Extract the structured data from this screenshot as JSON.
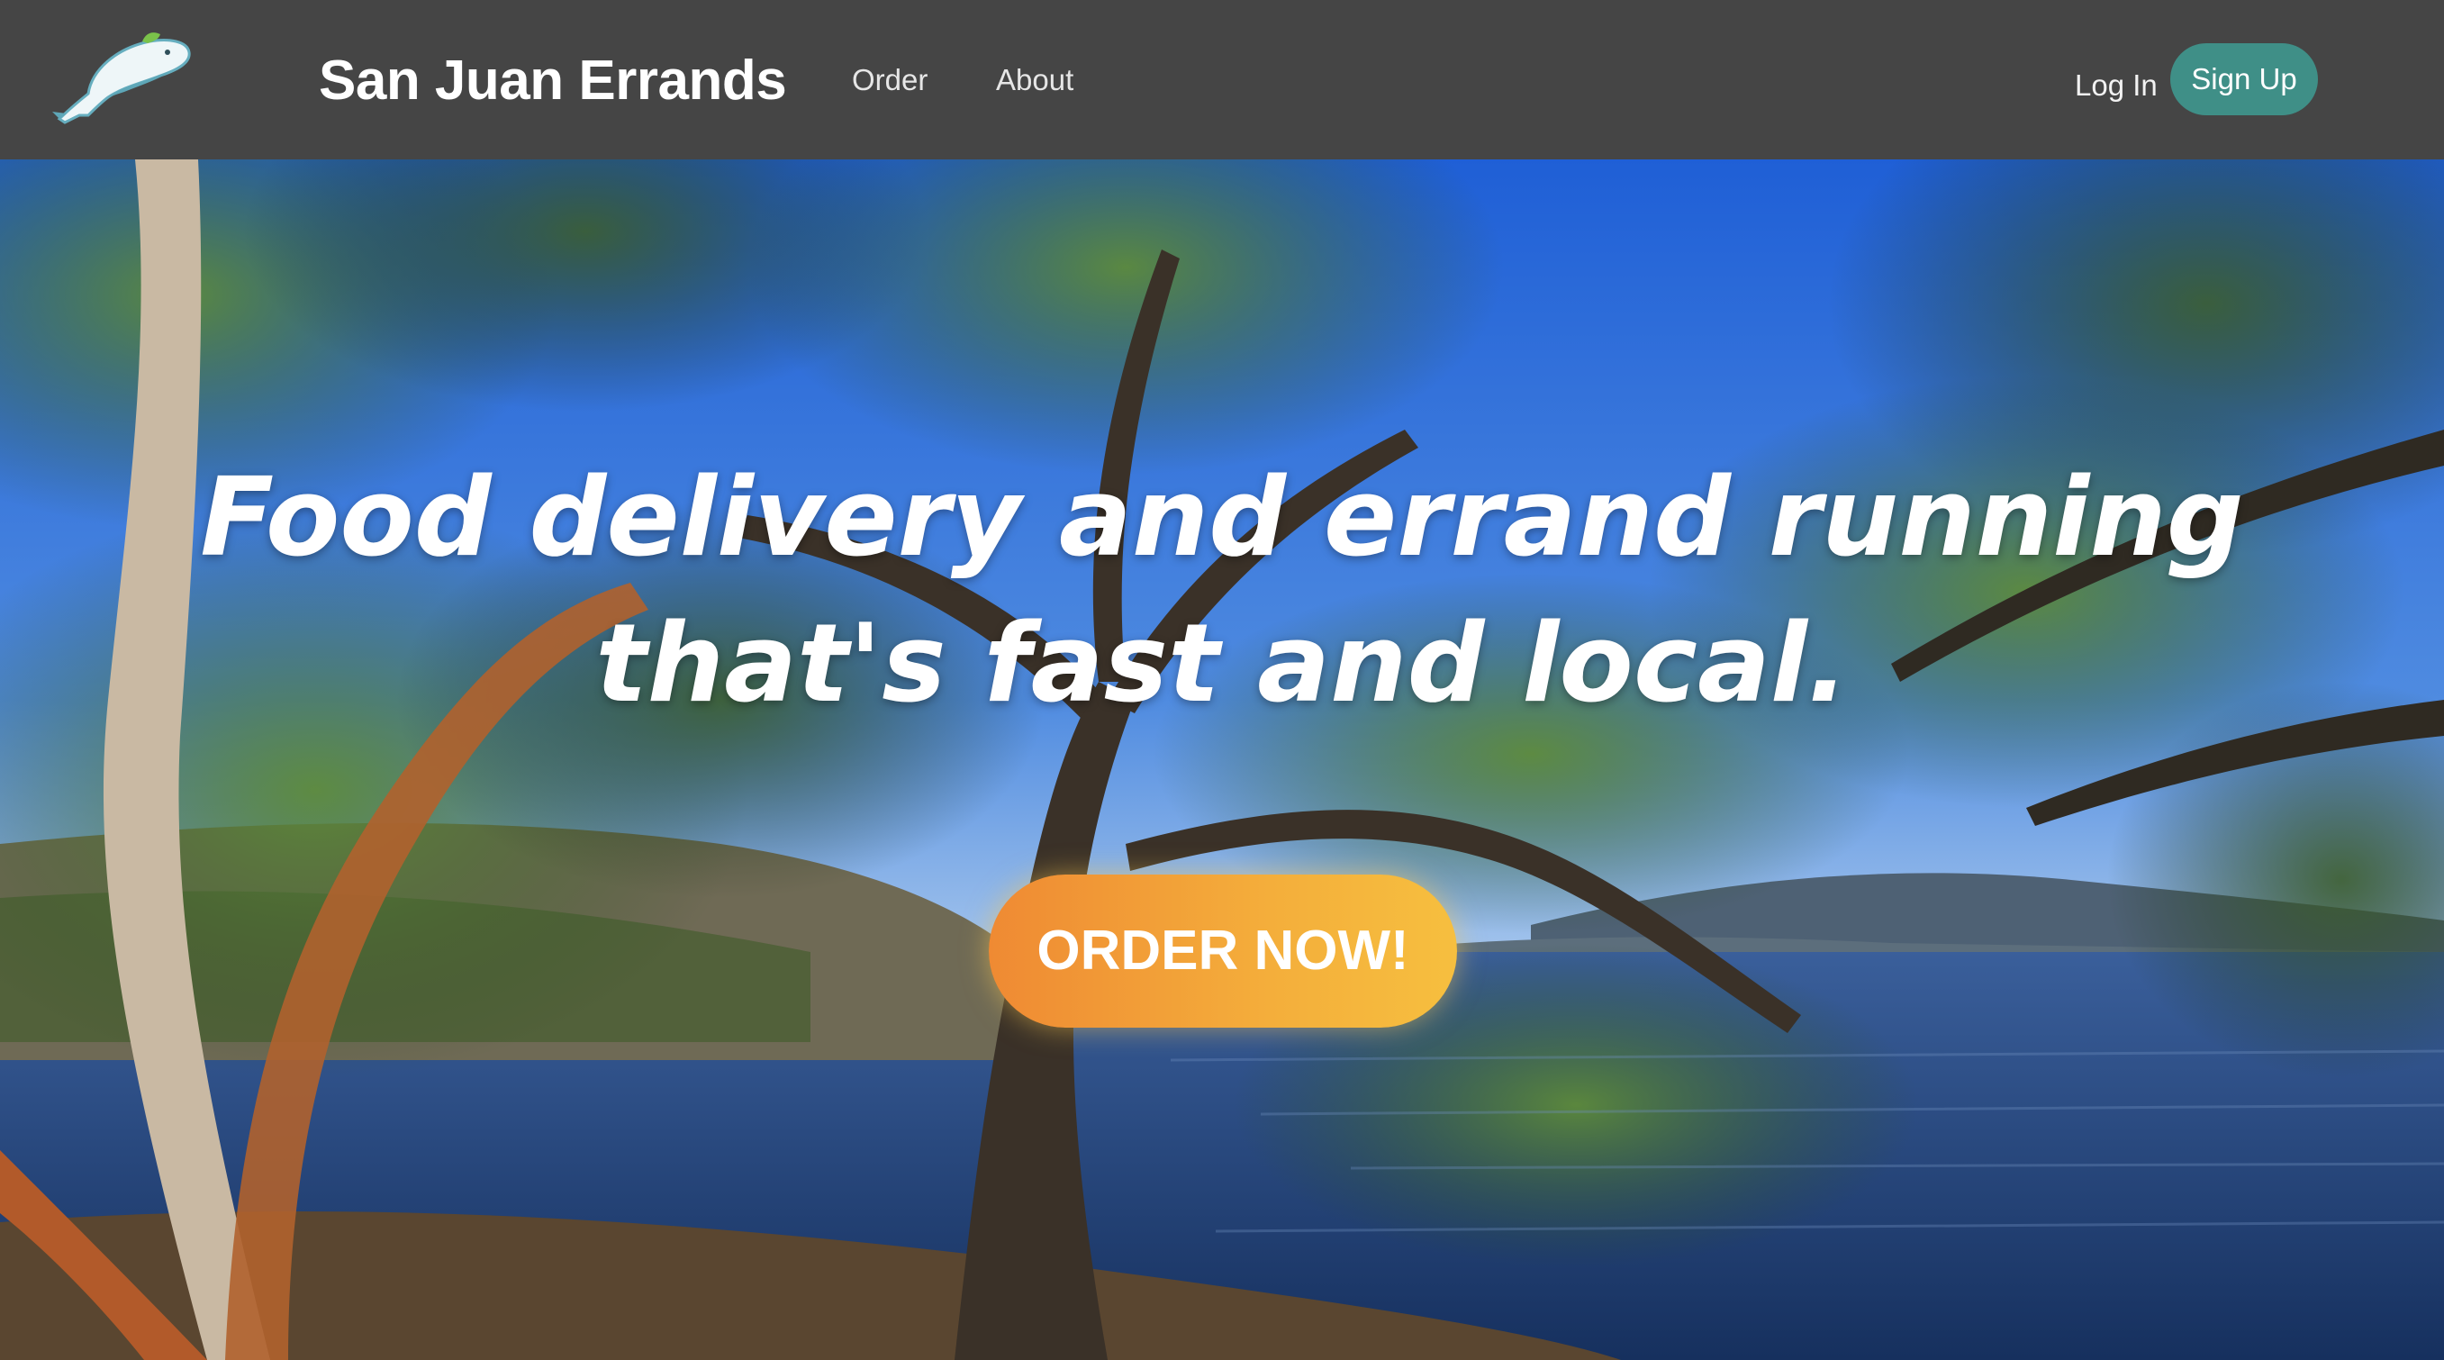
{
  "navbar": {
    "logo_icon": "orca-whale-logo-icon",
    "brand": "San Juan Errands",
    "links": [
      {
        "label": "Order"
      },
      {
        "label": "About"
      }
    ],
    "login_label": "Log In",
    "signup_label": "Sign Up",
    "colors": {
      "background": "#454545",
      "signup": "#3f8f87"
    }
  },
  "hero": {
    "background_image": "trees-over-water-scene",
    "headline_lines": [
      "Food delivery and errand running",
      "that's fast and local."
    ],
    "cta_label": "ORDER NOW!",
    "colors": {
      "cta_start": "#ef8a33",
      "cta_end": "#f6bf3f"
    }
  }
}
